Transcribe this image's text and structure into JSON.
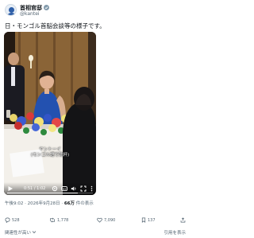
{
  "account": {
    "name": "首相官邸",
    "handle": "@kantei"
  },
  "post": {
    "text": "日・モンゴル首脳会談等の様子です。"
  },
  "video": {
    "caption_line1": "ヤントーイ",
    "caption_line2": "(モンゴル語で乾杯)",
    "time_readout": "0:51 / 1:02",
    "progress": 0.82
  },
  "meta": {
    "posted": "午後9:02 · 2026年9月28日 · ",
    "views_count": "66万",
    "views_suffix": " 件の表示"
  },
  "actions": {
    "replies": "528",
    "reposts": "1,778",
    "likes": "7,090",
    "bookmarks": "137"
  },
  "footer": {
    "left_link": "関連性が高い",
    "right_link": "引用を表示"
  },
  "colors": {
    "verified_badge": "#829aab",
    "progress_fill": "#ffffff",
    "text_secondary": "#536471"
  }
}
